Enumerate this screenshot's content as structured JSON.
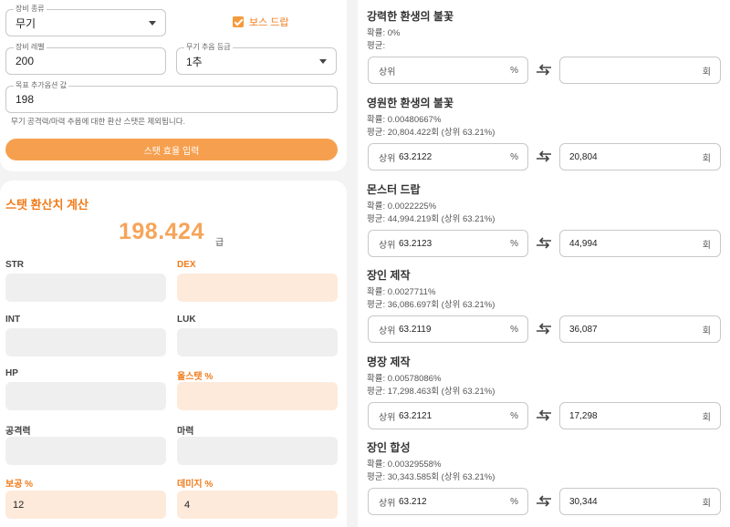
{
  "equip": {
    "type_label": "장비 종류",
    "type_value": "무기",
    "boss_drop_label": "보스 드랍",
    "level_label": "장비 레벨",
    "level_value": "200",
    "flame_grade_label": "무기 추옵 등급",
    "flame_grade_value": "1추",
    "target_label": "목표 추가옵션 값",
    "target_value": "198",
    "helper_text": "무기 공격력/마력 추옵에 대한 환산 스탯은 제외됩니다.",
    "stat_input_button": "스탯 효율 입력"
  },
  "calc": {
    "title": "스탯 환산치 계산",
    "score": "198.424",
    "score_unit": "급",
    "stats": [
      {
        "label": "STR",
        "value": ""
      },
      {
        "label": "DEX",
        "value": ""
      },
      {
        "label": "INT",
        "value": ""
      },
      {
        "label": "LUK",
        "value": ""
      },
      {
        "label": "HP",
        "value": ""
      },
      {
        "label": "올스탯 %",
        "value": ""
      },
      {
        "label": "공격력",
        "value": ""
      },
      {
        "label": "마력",
        "value": ""
      },
      {
        "label": "보공 %",
        "value": "12"
      },
      {
        "label": "데미지 %",
        "value": "4"
      }
    ]
  },
  "flames": [
    {
      "title": "강력한 환생의 불꽃",
      "prob": "확률: 0%",
      "avg": "평균:",
      "pct_prefix": "상위",
      "pct_value": "",
      "pct_suffix": "%",
      "count_value": "",
      "count_suffix": "회"
    },
    {
      "title": "영원한 환생의 불꽃",
      "prob": "확률: 0.00480667%",
      "avg": "평균: 20,804.422회 (상위 63.21%)",
      "pct_prefix": "상위",
      "pct_value": "63.2122",
      "pct_suffix": "%",
      "count_value": "20,804",
      "count_suffix": "회"
    },
    {
      "title": "몬스터 드랍",
      "prob": "확률: 0.0022225%",
      "avg": "평균: 44,994.219회 (상위 63.21%)",
      "pct_prefix": "상위",
      "pct_value": "63.2123",
      "pct_suffix": "%",
      "count_value": "44,994",
      "count_suffix": "회"
    },
    {
      "title": "장인 제작",
      "prob": "확률: 0.0027711%",
      "avg": "평균: 36,086.697회 (상위 63.21%)",
      "pct_prefix": "상위",
      "pct_value": "63.2119",
      "pct_suffix": "%",
      "count_value": "36,087",
      "count_suffix": "회"
    },
    {
      "title": "명장 제작",
      "prob": "확률: 0.00578086%",
      "avg": "평균: 17,298.463회 (상위 63.21%)",
      "pct_prefix": "상위",
      "pct_value": "63.2121",
      "pct_suffix": "%",
      "count_value": "17,298",
      "count_suffix": "회"
    },
    {
      "title": "장인 합성",
      "prob": "확률: 0.00329558%",
      "avg": "평균: 30,343.585회 (상위 63.21%)",
      "pct_prefix": "상위",
      "pct_value": "63.212",
      "pct_suffix": "%",
      "count_value": "30,344",
      "count_suffix": "회"
    }
  ],
  "colors": {
    "accent": "#f07b1a",
    "button": "#f6a04f",
    "highlight_field": "#fdeadb",
    "field": "#efefef"
  }
}
